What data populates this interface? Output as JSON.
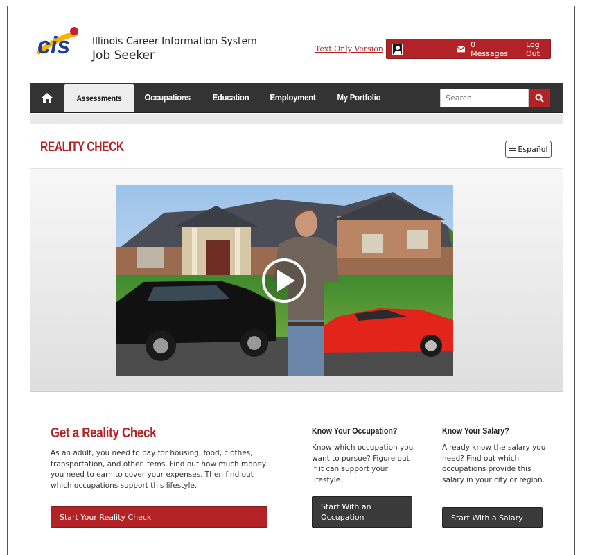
{
  "header": {
    "logo_text": "cis",
    "brand_line1": "Illinois Career Information System",
    "brand_line2": "Job Seeker",
    "text_only_link": "Text Only Version",
    "messages_label": "0 Messages",
    "logout_label": "Log Out"
  },
  "nav": {
    "tabs": [
      {
        "label": "Assessments",
        "active": true
      },
      {
        "label": "Occupations"
      },
      {
        "label": "Education"
      },
      {
        "label": "Employment"
      },
      {
        "label": "My Portfolio"
      }
    ],
    "search_placeholder": "Search"
  },
  "page": {
    "title": "REALITY CHECK",
    "language_button": "Español"
  },
  "sections": {
    "main": {
      "title": "Get a Reality Check",
      "text": "As an adult, you need to pay for housing, food, clothes, transportation, and other items. Find out how much money you need to earn to cover your expenses. Then find out which occupations support this lifestyle.",
      "button": "Start Your Reality Check"
    },
    "occupation": {
      "title": "Know Your Occupation?",
      "text": "Know which occupation you want to pursue? Figure out if it can support your lifestyle.",
      "button": "Start With an Occupation"
    },
    "salary": {
      "title": "Know Your Salary?",
      "text": "Already know the salary you need? Find out which occupations provide this salary in your city or region.",
      "button": "Start With a Salary"
    }
  },
  "colors": {
    "brand_red": "#b22226",
    "nav_dark": "#333333",
    "logo_blue": "#1c3f94",
    "logo_yellow": "#f4b400"
  },
  "icons": {
    "home": "home-icon",
    "user": "user-icon",
    "messages": "envelope-icon",
    "search": "search-icon",
    "language": "menu-bars-icon",
    "video": "play-icon"
  }
}
